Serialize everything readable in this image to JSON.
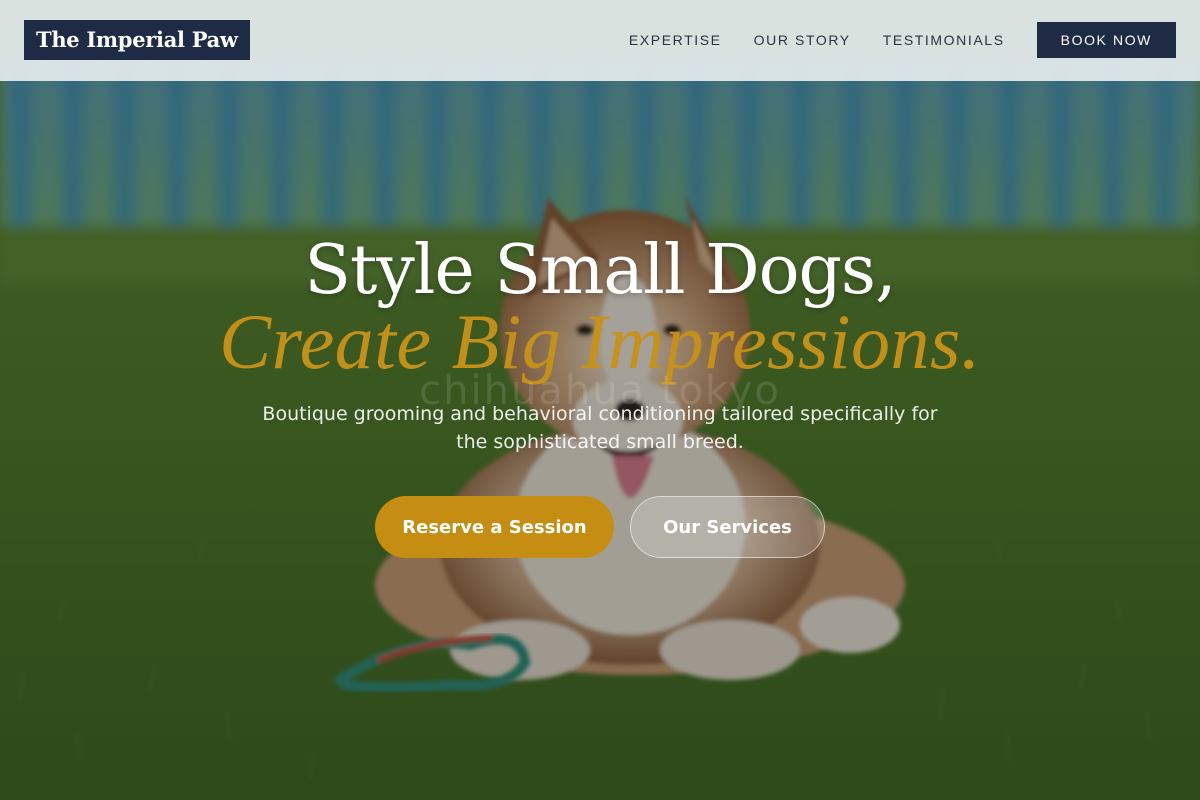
{
  "brand": {
    "name": "The Imperial Paw"
  },
  "nav": {
    "links": [
      "EXPERTISE",
      "OUR STORY",
      "TESTIMONIALS"
    ],
    "cta_label": "BOOK NOW"
  },
  "hero": {
    "headline_line1": "Style Small Dogs,",
    "headline_line2": "Create Big Impressions.",
    "subtitle": "Boutique grooming and behavioral conditioning tailored specifically for the sophisticated small breed.",
    "primary_button": "Reserve a Session",
    "secondary_button": "Our Services",
    "watermark": "chihuahua tokyo"
  },
  "colors": {
    "navy": "#1f2a44",
    "gold": "#c58e12",
    "header_bg": "#e4ecee",
    "grass": "#4e7a2a"
  },
  "icons": {
    "hero_image": "dog-on-grass-photo"
  }
}
